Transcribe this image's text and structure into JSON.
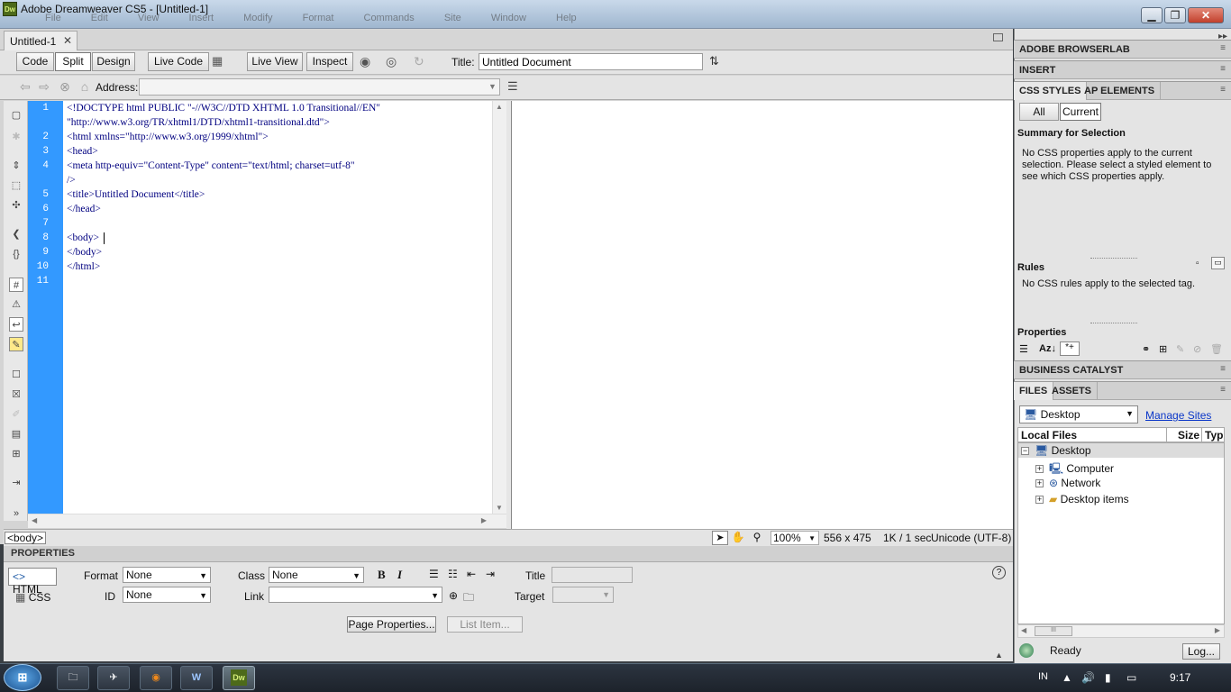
{
  "window": {
    "title": "Adobe Dreamweaver CS5 - [Untitled-1]",
    "logo": "Dw",
    "menu": [
      "File",
      "Edit",
      "View",
      "Insert",
      "Modify",
      "Format",
      "Commands",
      "Site",
      "Window",
      "Help"
    ],
    "min_label": "▁",
    "max_label": "❐",
    "close_label": "✕"
  },
  "document": {
    "tab_name": "Untitled-1",
    "tab_close": "✕",
    "toolbar": {
      "code": "Code",
      "split": "Split",
      "design": "Design",
      "live_code": "Live Code",
      "live_view": "Live View",
      "inspect": "Inspect",
      "title_label": "Title:",
      "title_value": "Untitled Document"
    },
    "address_label": "Address:",
    "code_lines": [
      {
        "n": "1",
        "text": "<!DOCTYPE html PUBLIC \"-//W3C//DTD XHTML 1.0 Transitional//EN\""
      },
      {
        "n": "",
        "text": "\"http://www.w3.org/TR/xhtml1/DTD/xhtml1-transitional.dtd\">"
      },
      {
        "n": "2",
        "text": "<html xmlns=\"http://www.w3.org/1999/xhtml\">"
      },
      {
        "n": "3",
        "text": "<head>"
      },
      {
        "n": "4",
        "text": "<meta http-equiv=\"Content-Type\" content=\"text/html; charset=utf-8\""
      },
      {
        "n": "",
        "text": "/>"
      },
      {
        "n": "5",
        "text": "<title>Untitled Document</title>"
      },
      {
        "n": "6",
        "text": "</head>"
      },
      {
        "n": "7",
        "text": ""
      },
      {
        "n": "8",
        "text": "<body>"
      },
      {
        "n": "9",
        "text": "</body>"
      },
      {
        "n": "10",
        "text": "</html>"
      },
      {
        "n": "11",
        "text": ""
      }
    ]
  },
  "status": {
    "tag": "<body>",
    "zoom": "100%",
    "size": "556 x 475",
    "download": "1K / 1 sec",
    "encoding": "Unicode (UTF-8)"
  },
  "properties": {
    "header": "PROPERTIES",
    "html_btn": "HTML",
    "css_btn": "CSS",
    "format_label": "Format",
    "format_value": "None",
    "id_label": "ID",
    "id_value": "None",
    "class_label": "Class",
    "class_value": "None",
    "link_label": "Link",
    "title_label": "Title",
    "target_label": "Target",
    "page_props": "Page Properties...",
    "list_item": "List Item..."
  },
  "panels": {
    "browserlab": "ADOBE BROWSERLAB",
    "insert": "INSERT",
    "css_tab": "CSS STYLES",
    "ap_tab": "AP ELEMENTS",
    "all_btn": "All",
    "current_btn": "Current",
    "summary_title": "Summary for Selection",
    "summary_text": "No CSS properties apply to the current selection.  Please select a styled element to see which CSS properties apply.",
    "rules_title": "Rules",
    "rules_text": "No CSS rules apply to the selected tag.",
    "properties_title": "Properties",
    "business_catalyst": "BUSINESS CATALYST",
    "files_tab": "FILES",
    "assets_tab": "ASSETS",
    "site_select": "Desktop",
    "manage_sites": "Manage Sites",
    "col_local": "Local Files",
    "col_size": "Size",
    "col_type": "Typ",
    "tree": [
      {
        "label": "Desktop",
        "expander": "−"
      },
      {
        "label": "Computer",
        "expander": "+"
      },
      {
        "label": "Network",
        "expander": "+"
      },
      {
        "label": "Desktop items",
        "expander": "+"
      }
    ],
    "ready": "Ready",
    "log": "Log..."
  },
  "taskbar": {
    "lang": "IN",
    "time": "9:17",
    "dw_label": "Dw"
  },
  "colors": {
    "gutter": "#3399ff",
    "code_text": "#000080",
    "link": "#0a36c8"
  }
}
